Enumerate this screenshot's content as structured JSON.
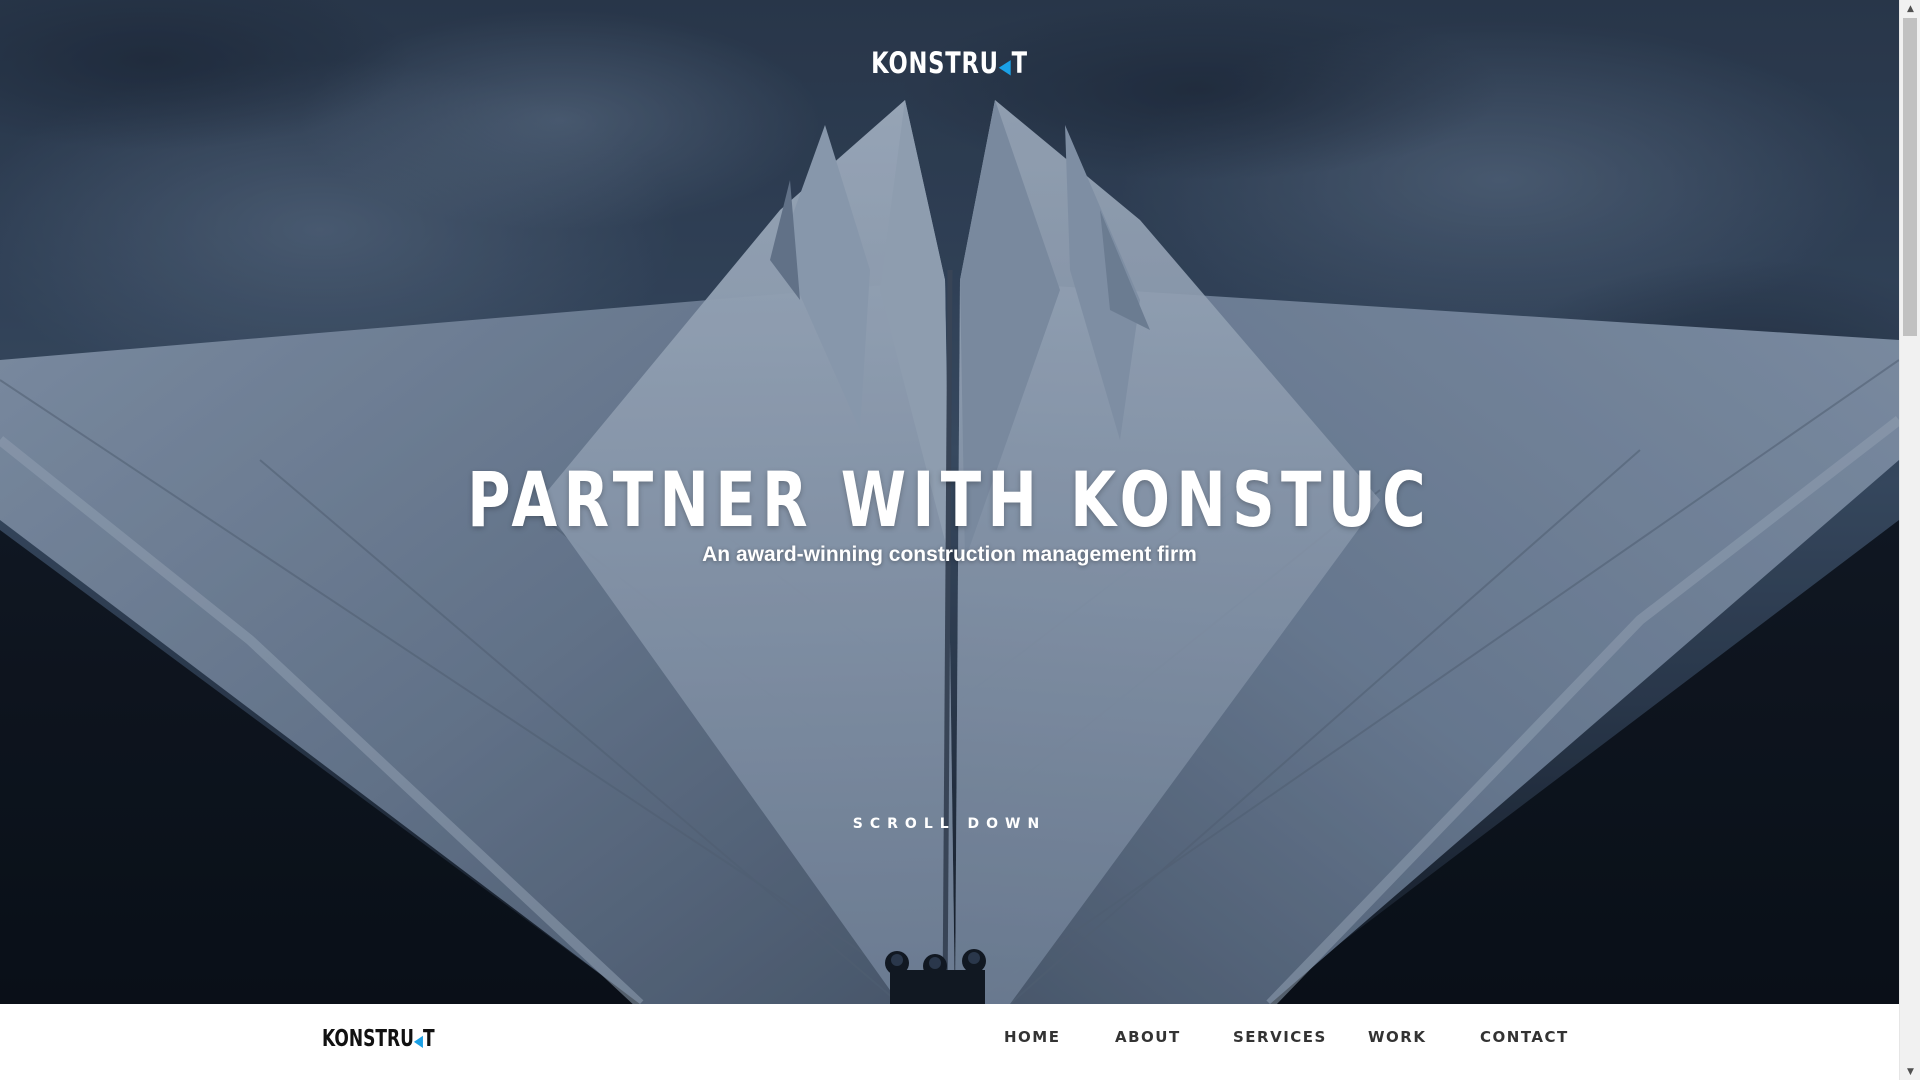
{
  "hero": {
    "logo_main": "KONSTRU",
    "logo_accent": "◀",
    "logo_end": "T",
    "title": "PARTNER WITH KONSTUC",
    "subtitle": "An award-winning construction management firm",
    "scroll_label": "SCROLL DOWN"
  },
  "navbar": {
    "logo_main": "KONSTRU",
    "logo_accent": "◀",
    "logo_end": "T",
    "items": [
      {
        "label": "HOME"
      },
      {
        "label": "ABOUT"
      },
      {
        "label": "SERVICES"
      },
      {
        "label": "WORK"
      },
      {
        "label": "CONTACT"
      }
    ]
  },
  "colors": {
    "accent": "#1aa0e6",
    "nav_background": "#ffffff",
    "nav_text": "#333333"
  },
  "icons": {
    "scroll_up": "triangle-up-icon",
    "scroll_down": "triangle-down-icon"
  }
}
